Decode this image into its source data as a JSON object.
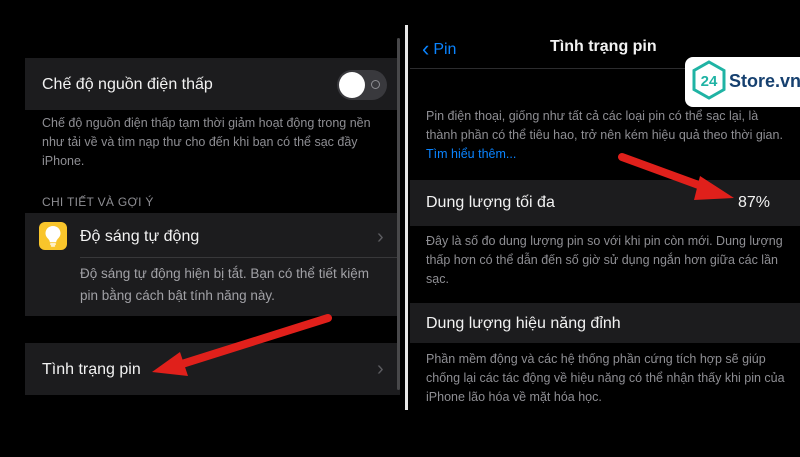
{
  "left_panel": {
    "low_power_mode": {
      "label": "Chế độ nguồn điện thấp",
      "toggle_on": false,
      "footnote": "Chế độ nguồn điện thấp tạm thời giảm hoạt động trong nền như tải về và tìm nạp thư cho đến khi bạn có thể sạc đầy iPhone."
    },
    "section_header": "CHI TIẾT VÀ GỢI Ý",
    "auto_brightness": {
      "label": "Độ sáng tự động",
      "icon": "lightbulb-icon",
      "description": "Độ sáng tự động hiện bị tắt. Bạn có thể tiết kiệm pin bằng cách bật tính năng này."
    },
    "battery_health": {
      "label": "Tình trạng pin"
    }
  },
  "right_panel": {
    "nav": {
      "back_label": "Pin",
      "title": "Tình trạng pin"
    },
    "intro": {
      "text": "Pin điện thoại, giống như tất cả các loại pin có thể sạc lại, là thành phần có thể tiêu hao, trở nên kém hiệu quả theo thời gian.",
      "link": "Tìm hiểu thêm..."
    },
    "max_capacity": {
      "label": "Dung lượng tối đa",
      "value": "87%",
      "footnote": "Đây là số đo dung lượng pin so với khi pin còn mới. Dung lượng thấp hơn có thể dẫn đến số giờ sử dụng ngắn hơn giữa các lần sạc."
    },
    "peak_performance": {
      "label": "Dung lượng hiệu năng đỉnh",
      "footnote": "Phần mềm động và các hệ thống phần cứng tích hợp sẽ giúp chống lại các tác động về hiệu năng có thể nhận thấy khi pin của iPhone lão hóa về mặt hóa học."
    }
  },
  "watermark": {
    "badge": "24",
    "brand": "Store.vn"
  },
  "colors": {
    "background": "#000000",
    "cell": "#1c1c1e",
    "accent_blue": "#0a84ff",
    "annotation_red": "#e0201b",
    "bulb_yellow": "#f9c52b"
  }
}
